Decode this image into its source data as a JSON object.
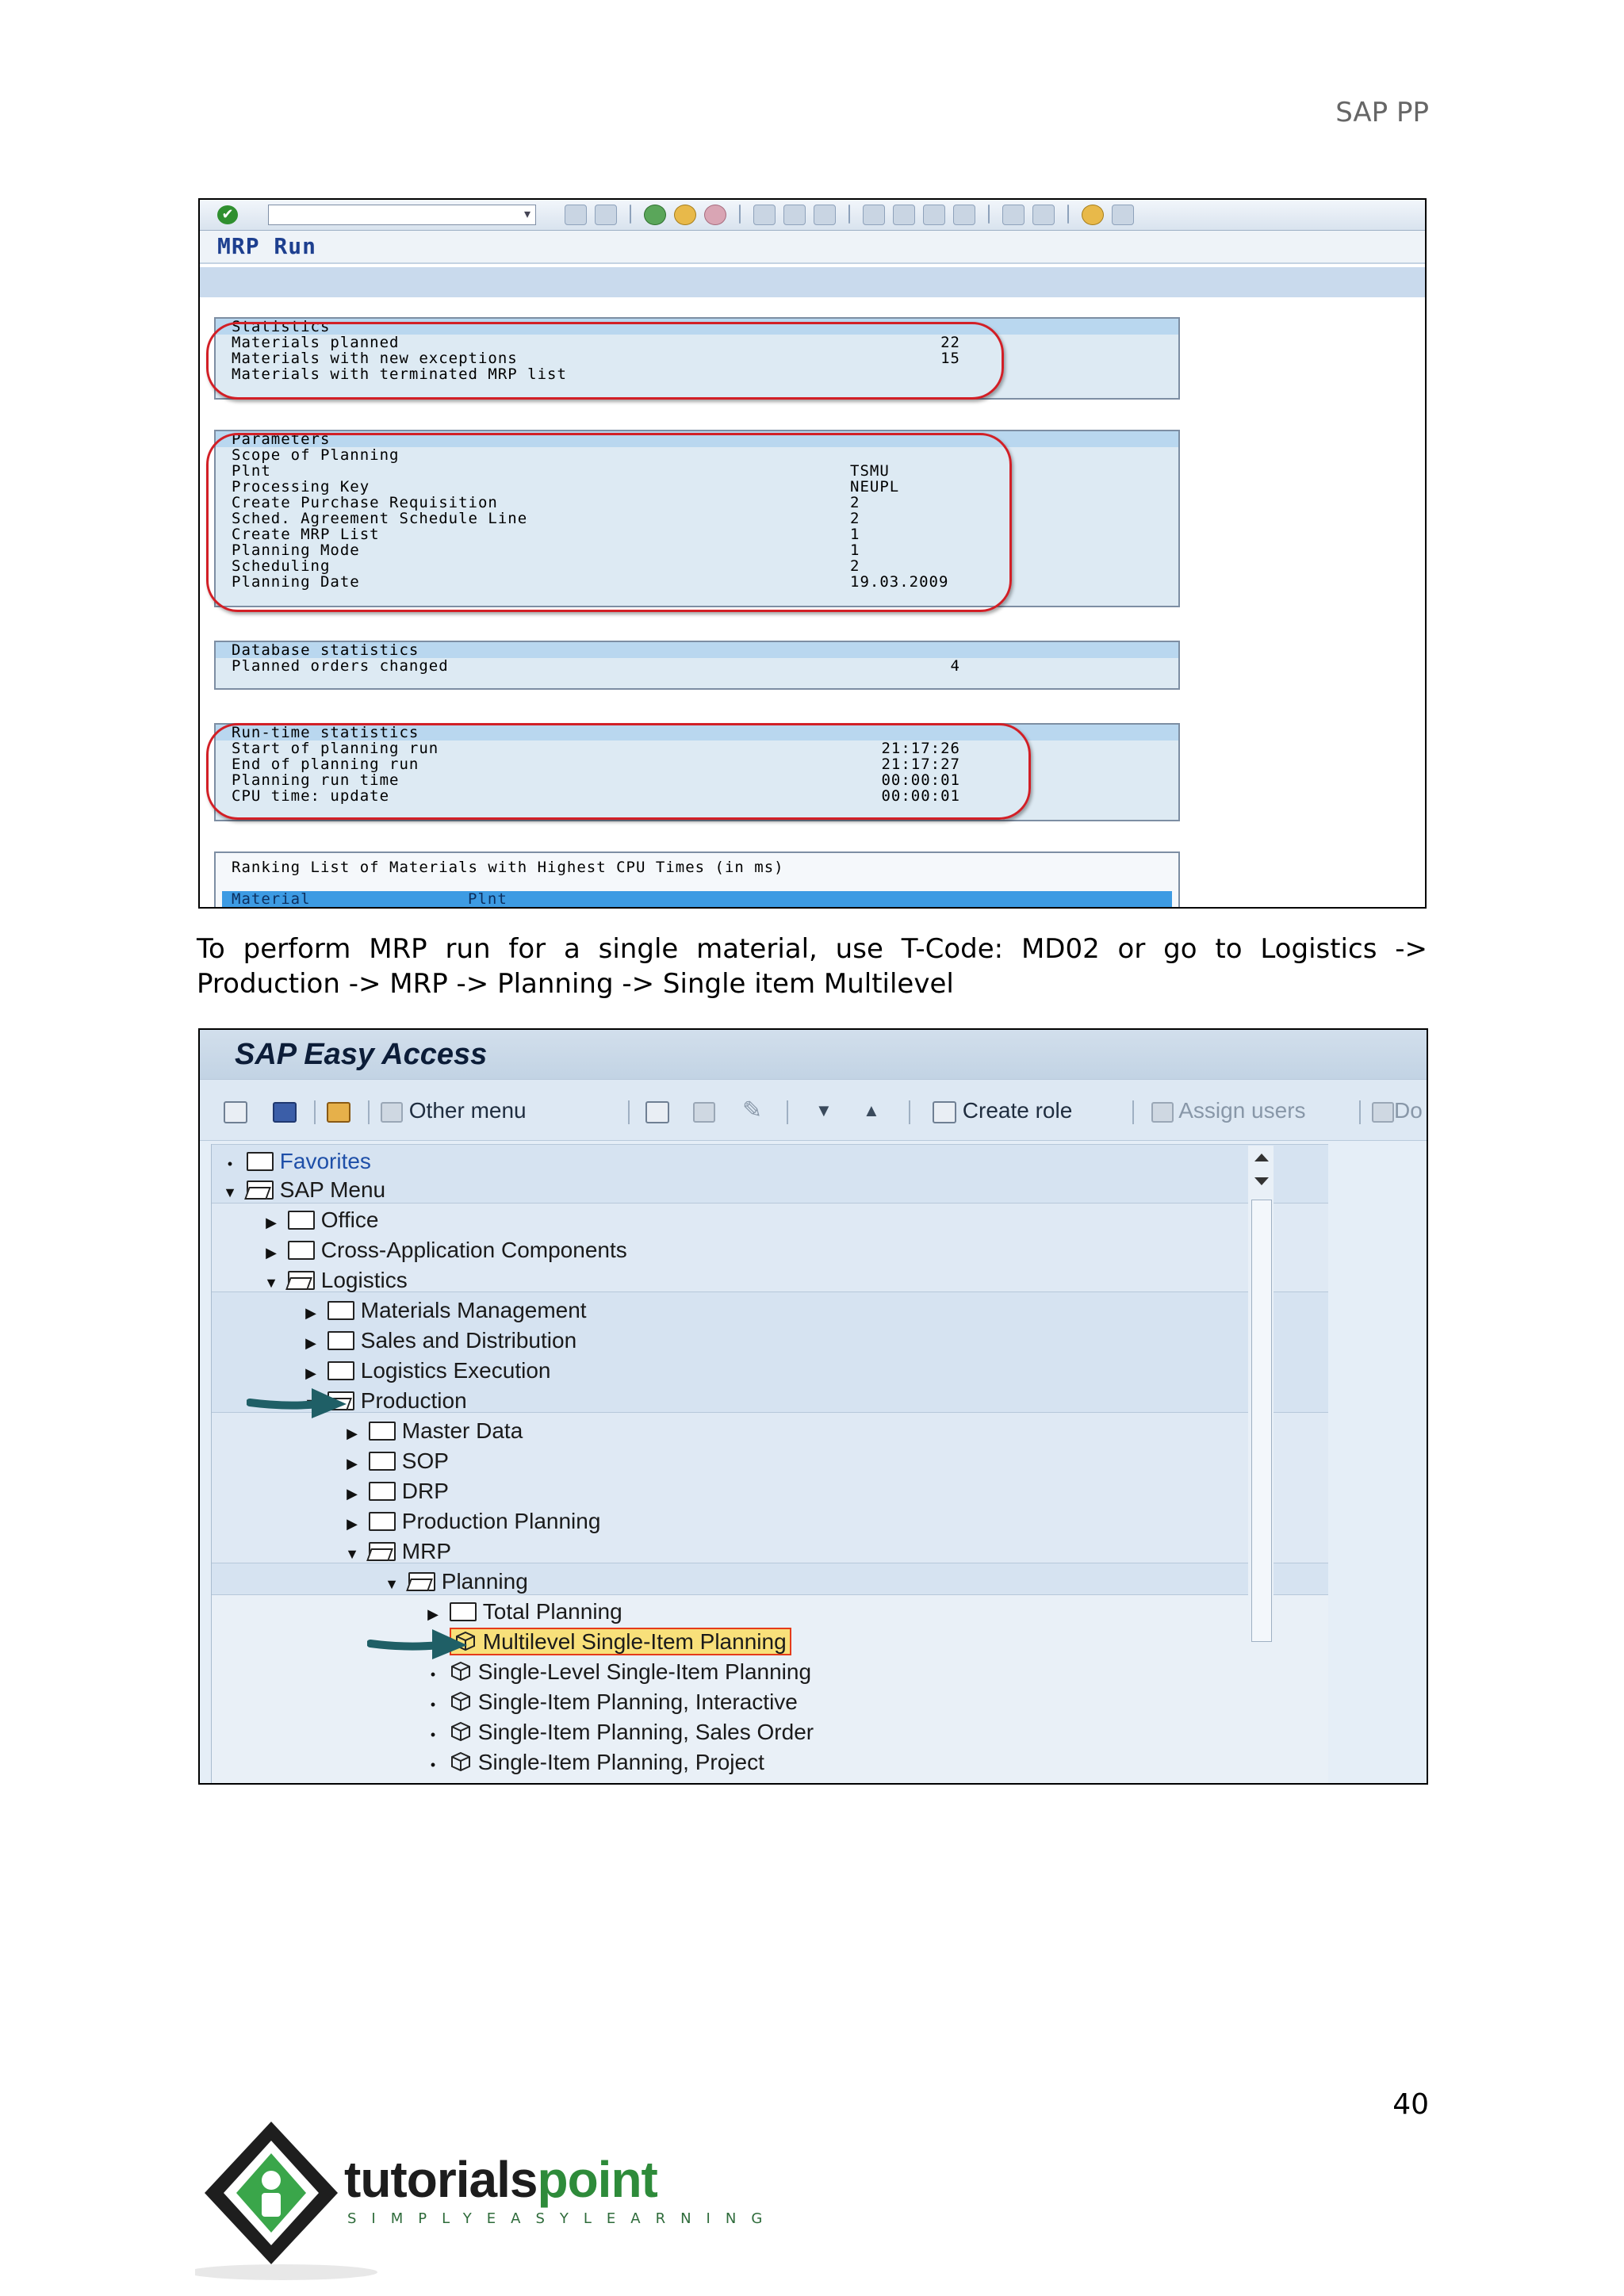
{
  "header": {
    "title": "SAP PP"
  },
  "page_number": "40",
  "mrp_run": {
    "title": "MRP Run",
    "statistics": {
      "heading": "Statistics",
      "rows": [
        {
          "label": "Materials planned",
          "value": "22"
        },
        {
          "label": "Materials with new exceptions",
          "value": "15"
        },
        {
          "label": "Materials with terminated MRP list",
          "value": ""
        }
      ]
    },
    "parameters": {
      "heading": "Parameters",
      "rows": [
        {
          "label": "Scope of Planning",
          "value": ""
        },
        {
          "label": "Plnt",
          "value": "TSMU"
        },
        {
          "label": "Processing Key",
          "value": "NEUPL"
        },
        {
          "label": "Create Purchase Requisition",
          "value": "2"
        },
        {
          "label": "Sched. Agreement Schedule Line",
          "value": "2"
        },
        {
          "label": "Create MRP List",
          "value": "1"
        },
        {
          "label": "Planning Mode",
          "value": "1"
        },
        {
          "label": "Scheduling",
          "value": "2"
        },
        {
          "label": "Planning Date",
          "value": "19.03.2009"
        }
      ]
    },
    "database": {
      "heading": "Database statistics",
      "rows": [
        {
          "label": "Planned orders changed",
          "value": "4"
        }
      ]
    },
    "runtime": {
      "heading": "Run-time statistics",
      "rows": [
        {
          "label": "Start of planning run",
          "value": "21:17:26"
        },
        {
          "label": "End of planning run",
          "value": "21:17:27"
        },
        {
          "label": "Planning run time",
          "value": "00:00:01"
        },
        {
          "label": "CPU time: update",
          "value": "00:00:01"
        }
      ]
    },
    "ranking": {
      "heading": "Ranking List of Materials with Highest CPU Times (in ms)",
      "columns": [
        "Material",
        "Plnt"
      ]
    }
  },
  "paragraph": {
    "line1": "To perform MRP run for a single material, use T-Code: MD02 or go to Logistics ->",
    "line2": "Production -> MRP -> Planning -> Single item Multilevel"
  },
  "easy_access": {
    "title": "SAP Easy Access",
    "toolbar": {
      "other_menu": "Other menu",
      "create_role": "Create role",
      "assign_users": "Assign users",
      "documentation_partial": "Do"
    },
    "tree": [
      {
        "label": "Favorites",
        "icon": "folder-icon"
      },
      {
        "label": "SAP Menu",
        "icon": "folder-open-icon"
      },
      {
        "label": "Office",
        "icon": "folder-icon"
      },
      {
        "label": "Cross-Application Components",
        "icon": "folder-icon"
      },
      {
        "label": "Logistics",
        "icon": "folder-open-icon"
      },
      {
        "label": "Materials Management",
        "icon": "folder-icon"
      },
      {
        "label": "Sales and Distribution",
        "icon": "folder-icon"
      },
      {
        "label": "Logistics Execution",
        "icon": "folder-icon"
      },
      {
        "label": "Production",
        "icon": "folder-open-icon"
      },
      {
        "label": "Master Data",
        "icon": "folder-icon"
      },
      {
        "label": "SOP",
        "icon": "folder-icon"
      },
      {
        "label": "DRP",
        "icon": "folder-icon"
      },
      {
        "label": "Production Planning",
        "icon": "folder-icon"
      },
      {
        "label": "MRP",
        "icon": "folder-open-icon"
      },
      {
        "label": "Planning",
        "icon": "folder-open-icon"
      },
      {
        "label": "Total Planning",
        "icon": "folder-icon"
      },
      {
        "label": "Multilevel Single-Item Planning",
        "icon": "transaction-cube-icon",
        "selected": true
      },
      {
        "label": "Single-Level Single-Item Planning",
        "icon": "transaction-cube-icon"
      },
      {
        "label": "Single-Item Planning, Interactive",
        "icon": "transaction-cube-icon"
      },
      {
        "label": "Single-Item Planning, Sales Order",
        "icon": "transaction-cube-icon"
      },
      {
        "label": "Single-Item Planning, Project",
        "icon": "transaction-cube-icon"
      }
    ]
  },
  "logo": {
    "name_part1": "tutorials",
    "name_part2": "point",
    "tagline": "SIMPLYEASYLEARNING"
  },
  "colors": {
    "sap_blue": "#1d3f8f",
    "highlight": "#f8e07a",
    "ring": "#d21f26",
    "logo_green": "#2e8b3a"
  }
}
